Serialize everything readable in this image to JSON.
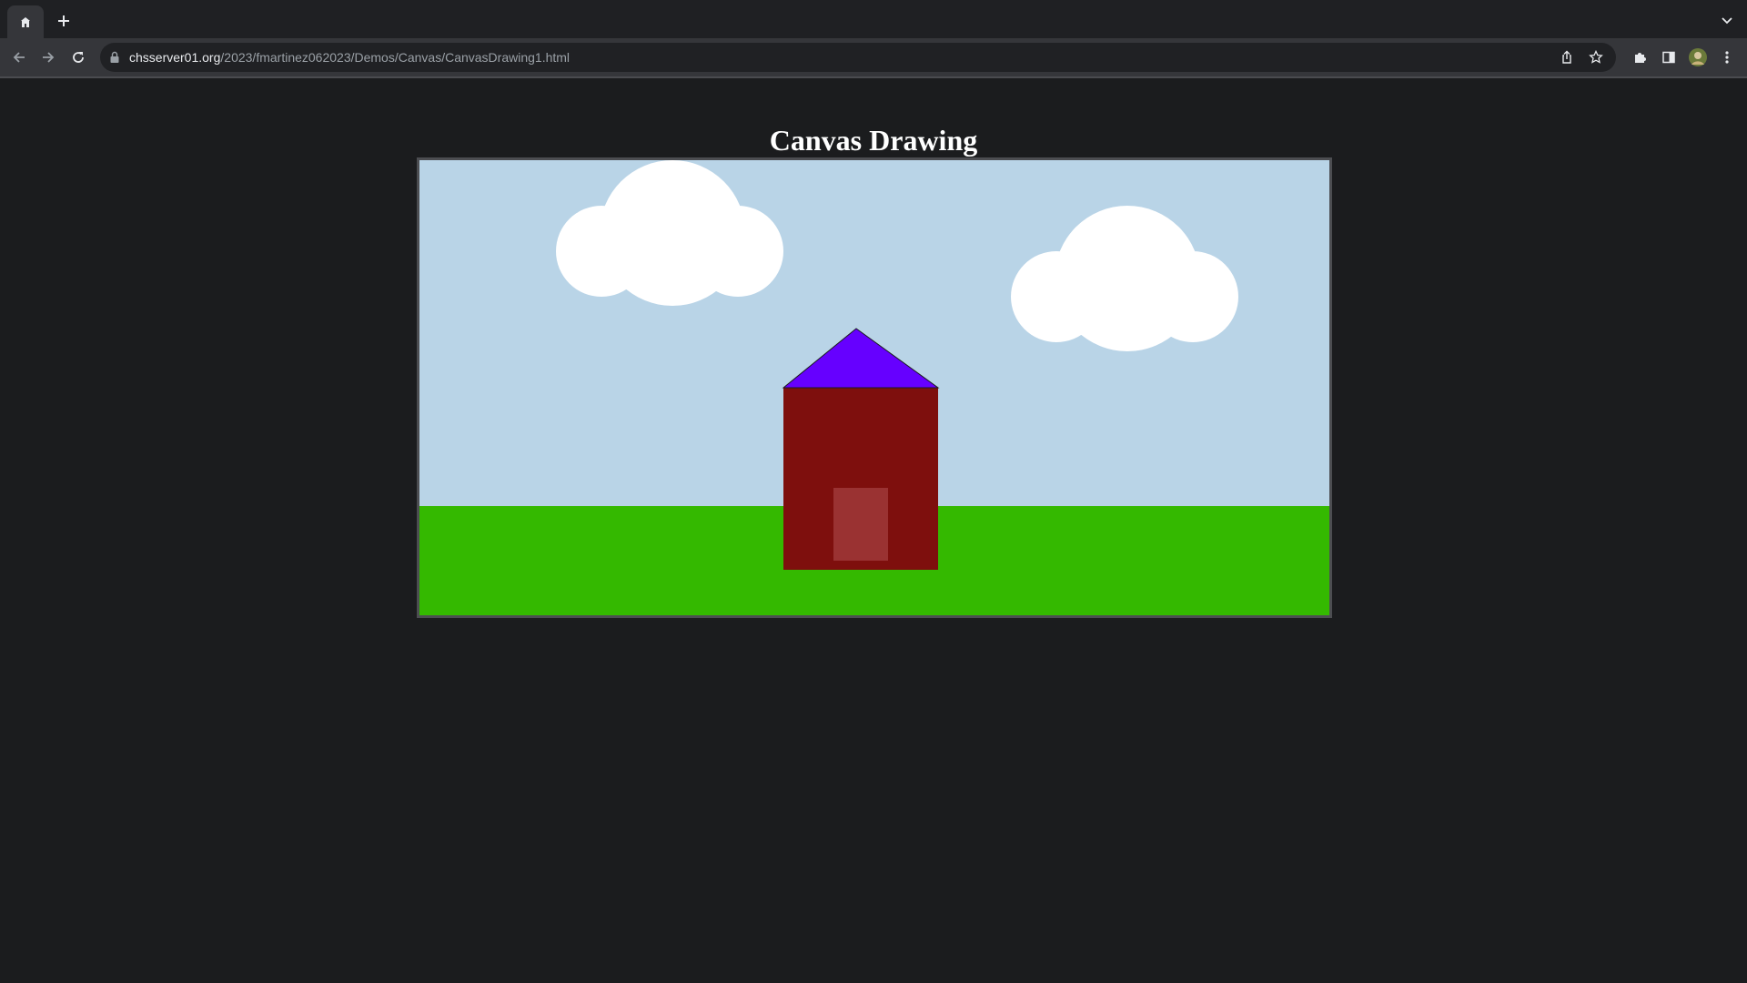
{
  "browser": {
    "tab_icon": "page-favicon-icon",
    "new_tab_icon": "plus-icon",
    "tab_menu_icon": "chevron-down-icon",
    "url_host": "chsserver01.org",
    "url_path": "/2023/fmartinez062023/Demos/Canvas/CanvasDrawing1.html",
    "nav_icons": [
      "back-arrow-icon",
      "forward-arrow-icon",
      "reload-icon",
      "lock-icon"
    ],
    "right_icons": [
      "share-icon",
      "star-icon",
      "puzzle-icon",
      "side-panel-icon",
      "avatar",
      "kebab-menu-icon"
    ]
  },
  "page": {
    "title": "Canvas Drawing"
  },
  "scene": {
    "sky_color": "#b9d4e7",
    "grass_color": "#34b900",
    "cloud_color": "#ffffff",
    "roof_color": "#6600ff",
    "house_color": "#7e0f0d",
    "door_color": "#9a3232"
  }
}
